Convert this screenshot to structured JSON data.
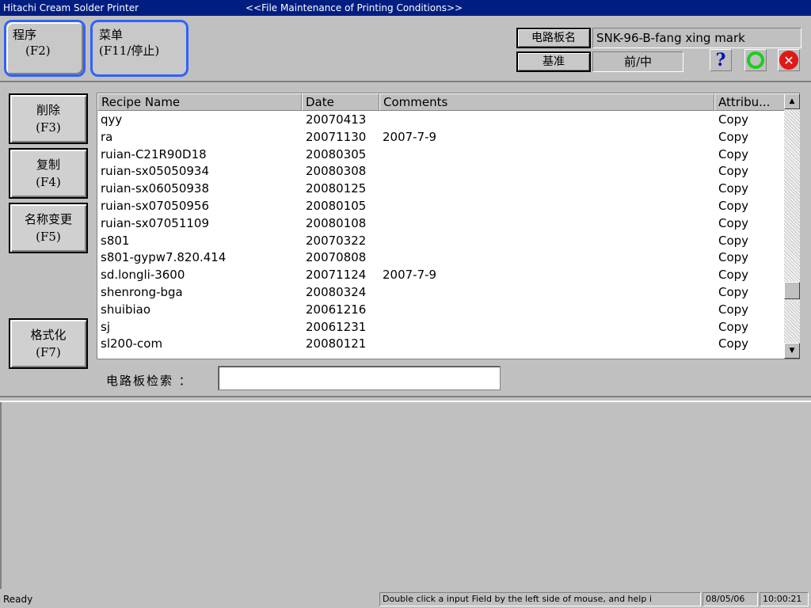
{
  "titlebar": {
    "app": "Hitachi Cream Solder Printer",
    "screen": "<<File Maintenance of Printing Conditions>>"
  },
  "modes": [
    {
      "label": "程序",
      "key": "(F2)"
    },
    {
      "label": "菜单",
      "key": "(F11/停止)"
    }
  ],
  "board": {
    "name_label": "电路板名",
    "name_value": "SNK-96-B-fang xing mark",
    "ref_label": "基准",
    "ref_value": "前/中"
  },
  "icons": {
    "help": "?",
    "ok": "ok-circle",
    "cancel": "✕"
  },
  "actions": [
    {
      "label": "削除",
      "key": "(F3)"
    },
    {
      "label": "复制",
      "key": "(F4)"
    },
    {
      "label": "名称变更",
      "key": "(F5)"
    },
    {
      "label": "格式化",
      "key": "(F7)"
    }
  ],
  "table": {
    "columns": [
      "Recipe Name",
      "Date",
      "Comments",
      "Attribu..."
    ],
    "rows": [
      {
        "name": "qyy",
        "date": "20070413",
        "comment": "",
        "attr": "Copy"
      },
      {
        "name": "ra",
        "date": "20071130",
        "comment": "2007-7-9",
        "attr": "Copy"
      },
      {
        "name": "ruian-C21R90D18",
        "date": "20080305",
        "comment": "",
        "attr": "Copy"
      },
      {
        "name": "ruian-sx05050934",
        "date": "20080308",
        "comment": "",
        "attr": "Copy"
      },
      {
        "name": "ruian-sx06050938",
        "date": "20080125",
        "comment": "",
        "attr": "Copy"
      },
      {
        "name": "ruian-sx07050956",
        "date": "20080105",
        "comment": "",
        "attr": "Copy"
      },
      {
        "name": "ruian-sx07051109",
        "date": "20080108",
        "comment": "",
        "attr": "Copy"
      },
      {
        "name": "s801",
        "date": "20070322",
        "comment": "",
        "attr": "Copy"
      },
      {
        "name": "s801-gypw7.820.414",
        "date": "20070808",
        "comment": "",
        "attr": "Copy"
      },
      {
        "name": "sd.longli-3600",
        "date": "20071124",
        "comment": "2007-7-9",
        "attr": "Copy"
      },
      {
        "name": "shenrong-bga",
        "date": "20080324",
        "comment": "",
        "attr": "Copy"
      },
      {
        "name": "shuibiao",
        "date": "20061216",
        "comment": "",
        "attr": "Copy"
      },
      {
        "name": "sj",
        "date": "20061231",
        "comment": "",
        "attr": "Copy"
      },
      {
        "name": "sl200-com",
        "date": "20080121",
        "comment": "",
        "attr": "Copy"
      }
    ]
  },
  "search": {
    "label": "电路板检索 ：",
    "value": ""
  },
  "status": {
    "ready": "Ready",
    "hint": "Double click a input Field by the left side of mouse, and help i",
    "date": "08/05/06",
    "time": "10:00:21"
  }
}
